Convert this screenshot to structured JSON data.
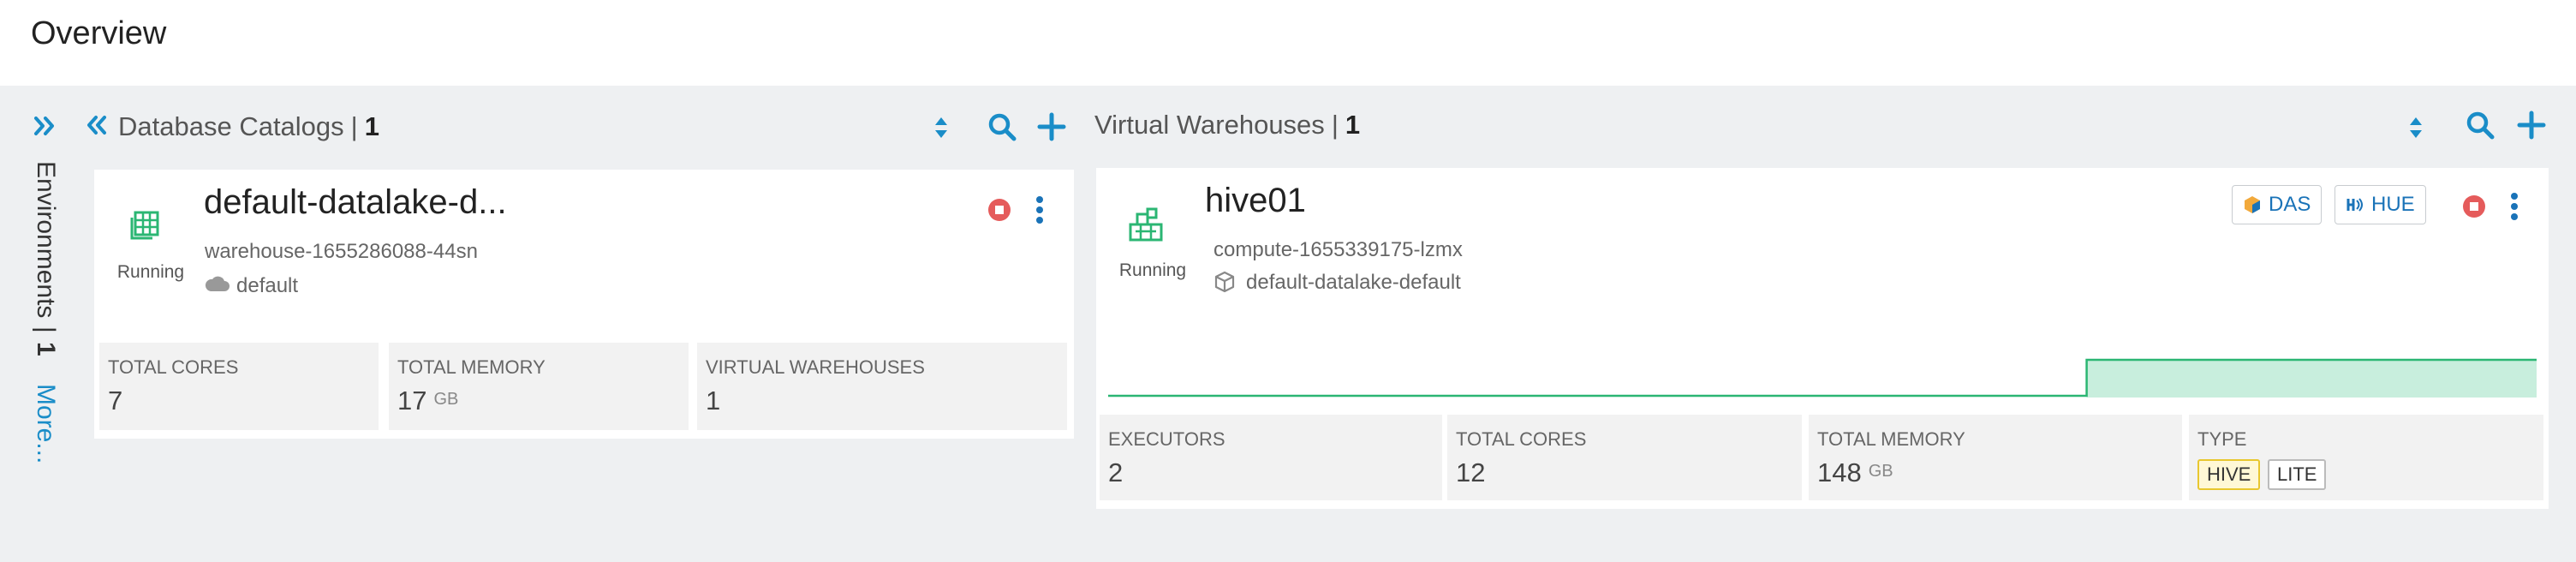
{
  "page": {
    "title": "Overview"
  },
  "environments": {
    "label": "Environments",
    "separator": "|",
    "count": "1",
    "more": "More..."
  },
  "database_catalogs": {
    "title": "Database Catalogs",
    "separator": "|",
    "count": "1",
    "card": {
      "name": "default-datalake-d...",
      "status": "Running",
      "warehouse_id": "warehouse-1655286088-44sn",
      "environment": "default",
      "stats": [
        {
          "label": "TOTAL CORES",
          "value": "7",
          "unit": ""
        },
        {
          "label": "TOTAL MEMORY",
          "value": "17",
          "unit": "GB"
        },
        {
          "label": "VIRTUAL WAREHOUSES",
          "value": "1",
          "unit": ""
        }
      ]
    }
  },
  "virtual_warehouses": {
    "title": "Virtual Warehouses",
    "separator": "|",
    "count": "1",
    "card": {
      "name": "hive01",
      "status": "Running",
      "compute_id": "compute-1655339175-lzmx",
      "catalog": "default-datalake-default",
      "buttons": {
        "das": "DAS",
        "hue": "HUE"
      },
      "activity_chart": {
        "low_fraction": 0.0,
        "step_at_fraction": 0.685,
        "high_fraction": 1.0
      },
      "stats": [
        {
          "label": "EXECUTORS",
          "value": "2",
          "unit": ""
        },
        {
          "label": "TOTAL CORES",
          "value": "12",
          "unit": ""
        },
        {
          "label": "TOTAL MEMORY",
          "value": "148",
          "unit": "GB"
        }
      ],
      "type": {
        "label": "TYPE",
        "tags": [
          "HIVE",
          "LITE"
        ]
      }
    }
  },
  "colors": {
    "accent": "#1a8dc8",
    "running": "#2bb673",
    "stop": "#e55b5b",
    "hive_tag": "#e8c72f"
  }
}
